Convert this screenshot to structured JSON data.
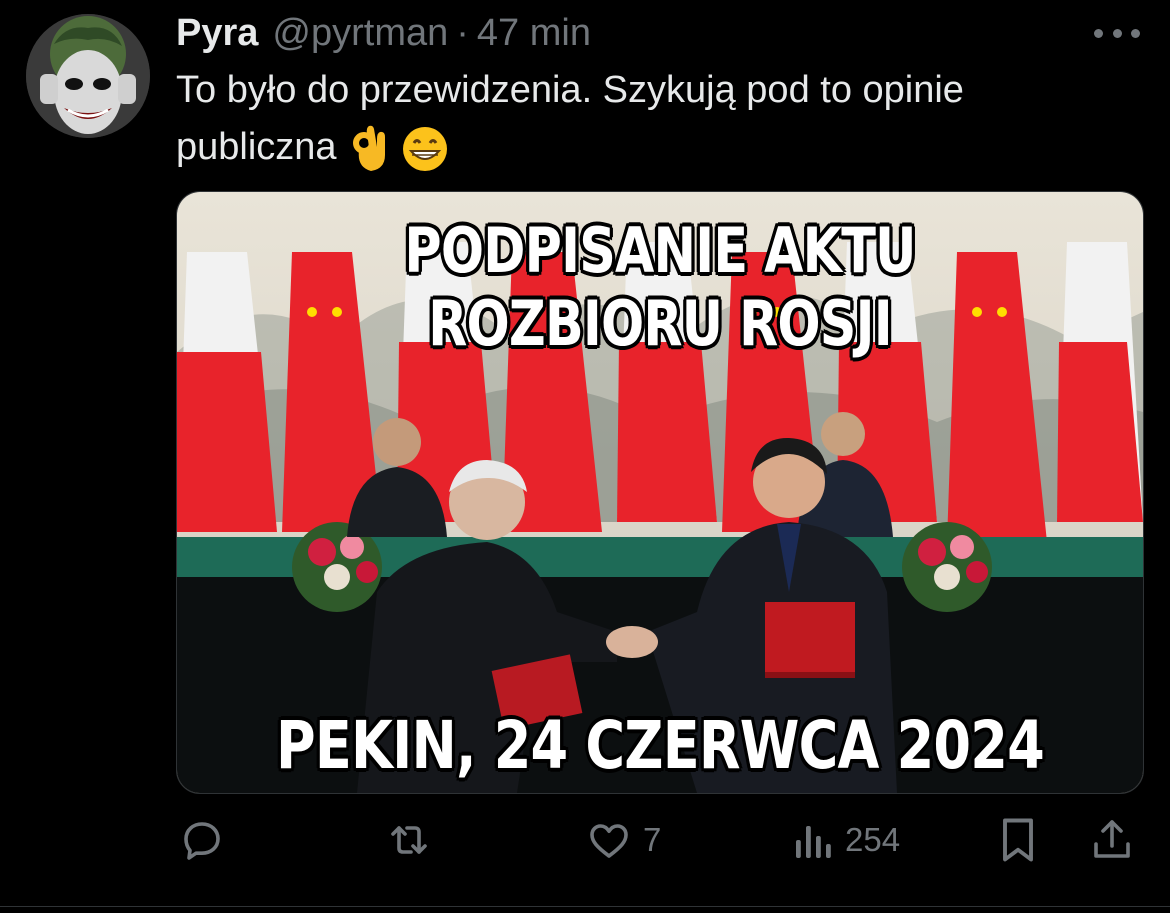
{
  "tweet": {
    "author_name": "Pyra",
    "author_handle": "@pyrtman",
    "separator": "·",
    "time": "47 min",
    "text_line1": "To było do przewidzenia. Szykują pod to opinie",
    "text_line2": "publiczna",
    "emojis": [
      "ok-hand-emoji",
      "grinning-emoji"
    ]
  },
  "media": {
    "caption_top": "PODPISANIE AKTU ROZBIORU ROSJI",
    "caption_bottom": "PEKIN, 24 CZERWCA 2024"
  },
  "actions": {
    "reply_count": "",
    "repost_count": "",
    "like_count": "7",
    "views_count": "254"
  },
  "icons": [
    "more-icon",
    "reply-icon",
    "repost-icon",
    "like-icon",
    "views-icon",
    "bookmark-icon",
    "share-icon"
  ],
  "colors": {
    "background": "#000000",
    "text_primary": "#e7e9ea",
    "text_secondary": "#71767b",
    "flag_red": "#e8232b",
    "flag_white": "#f2f2f2"
  }
}
